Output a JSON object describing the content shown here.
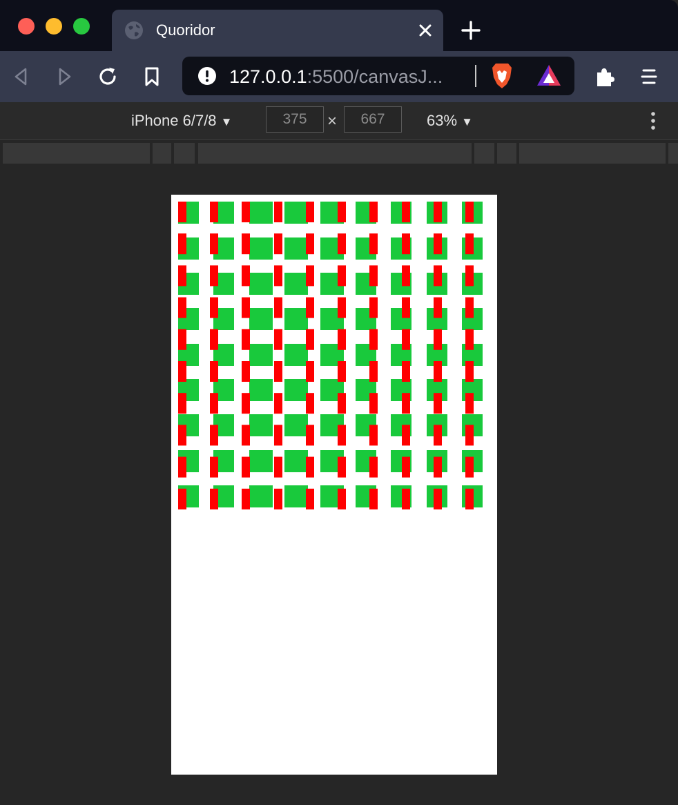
{
  "browser": {
    "tab_title": "Quoridor",
    "url_host": "127.0.0.1",
    "url_rest": ":5500/canvasJ...",
    "icons": {
      "tab": "globe-icon",
      "tab_close": "close-icon",
      "new_tab": "plus-icon",
      "back": "back-arrow-icon",
      "forward": "forward-arrow-icon",
      "reload": "reload-icon",
      "bookmark": "bookmark-icon",
      "site_info": "info-icon",
      "brave_shields": "brave-lion-icon",
      "brave_rewards": "rewards-triangle-icon",
      "extensions": "puzzle-icon",
      "menu": "hamburger-menu-icon"
    }
  },
  "device_toolbar": {
    "device": "iPhone 6/7/8",
    "width": "375",
    "height": "667",
    "times": "×",
    "zoom": "63%"
  },
  "game": {
    "grid_cols": 9,
    "grid_rows": 9,
    "colors": {
      "cell": "#19c93c",
      "wall": "#ff0000",
      "background": "#ffffff"
    }
  }
}
